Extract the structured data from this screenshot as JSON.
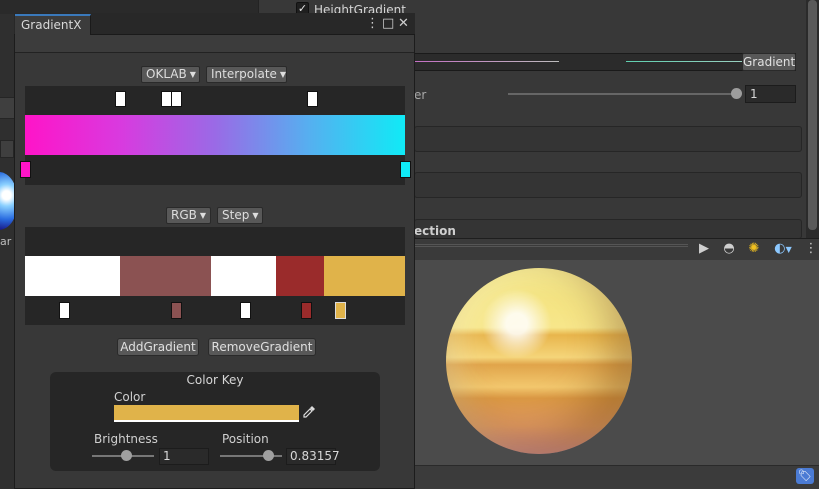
{
  "background": {
    "left_label": "ar 1",
    "inspector": {
      "checkbox_label": "HeightGradient",
      "checkbox_checked": true,
      "gradient_button": "Gradient",
      "slider_label": "er",
      "slider_value": "1",
      "section_label": "ection"
    },
    "preview_toolbar": {
      "play_icon": "▶",
      "sphere_icon": "◓",
      "lights_icon": "✺",
      "environment_icon": "◐",
      "more_icon": "⋮"
    },
    "footer_icon": "tag-icon"
  },
  "window": {
    "tab_title": "GradientX",
    "menu_icon": "⋮",
    "maximize_icon": "□",
    "close_icon": "✕"
  },
  "gradient1": {
    "color_space": "OKLAB",
    "mode": "Interpolate",
    "alpha_keys": [
      0.25,
      0.373,
      0.398,
      0.756
    ],
    "color_keys": [
      {
        "position": 0.0,
        "color": "#ff14c8"
      },
      {
        "position": 1.0,
        "color": "#10eaf6"
      }
    ]
  },
  "gradient2": {
    "color_space": "RGB",
    "mode": "Step",
    "color_keys": [
      {
        "position": 0.103,
        "color": "#ffffff"
      },
      {
        "position": 0.399,
        "color": "#8b5252"
      },
      {
        "position": 0.579,
        "color": "#ffffff"
      },
      {
        "position": 0.74,
        "color": "#9a2b2b"
      },
      {
        "position": 0.83157,
        "color": "#e0b34a"
      }
    ]
  },
  "buttons": {
    "add": "AddGradient",
    "remove": "RemoveGradient"
  },
  "color_key": {
    "title": "Color Key",
    "color_label": "Color",
    "color_value": "#e0b34a",
    "picker_icon": "eyedropper-icon",
    "brightness_label": "Brightness",
    "brightness_value": "1",
    "position_label": "Position",
    "position_value": "0.83157"
  }
}
